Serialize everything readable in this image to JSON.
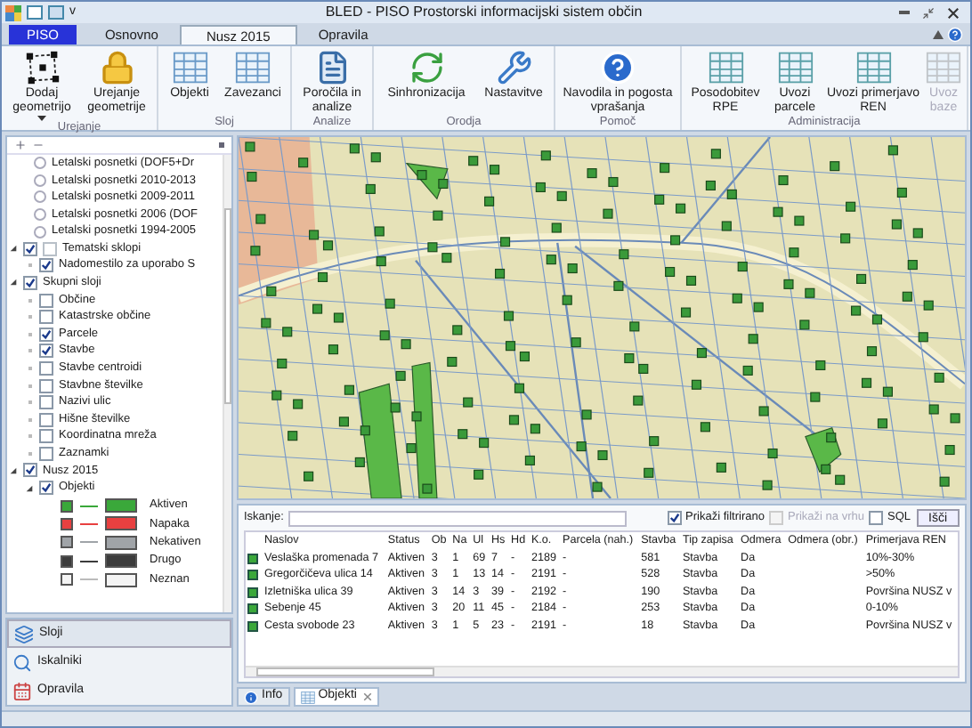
{
  "window": {
    "title": "BLED - PISO Prostorski informacijski sistem občin",
    "quick_access": "v"
  },
  "ribbon_tabs": [
    {
      "label": "PISO",
      "kind": "app",
      "selected": false
    },
    {
      "label": "Osnovno",
      "kind": "tab",
      "selected": false
    },
    {
      "label": "Nusz 2015",
      "kind": "tab",
      "selected": true
    },
    {
      "label": "Opravila",
      "kind": "tab",
      "selected": false
    }
  ],
  "ribbon_groups": [
    {
      "label": "Urejanje",
      "buttons": [
        {
          "label": "Dodaj geometrijo",
          "dropdown": true,
          "disabled": false
        },
        {
          "label": "Urejanje geometrije",
          "disabled": false
        }
      ]
    },
    {
      "label": "Sloj",
      "buttons": [
        {
          "label": "Objekti",
          "disabled": false
        },
        {
          "label": "Zavezanci",
          "disabled": false
        }
      ]
    },
    {
      "label": "Analize",
      "buttons": [
        {
          "label": "Poročila in analize",
          "disabled": false
        }
      ]
    },
    {
      "label": "Orodja",
      "buttons": [
        {
          "label": "Sinhronizacija",
          "disabled": false
        },
        {
          "label": "Nastavitve",
          "disabled": false
        }
      ]
    },
    {
      "label": "Pomoč",
      "buttons": [
        {
          "label": "Navodila in pogosta vprašanja",
          "disabled": false
        }
      ]
    },
    {
      "label": "Administracija",
      "buttons": [
        {
          "label": "Posodobitev RPE",
          "disabled": false
        },
        {
          "label": "Uvozi parcele",
          "disabled": false
        },
        {
          "label": "Uvozi primerjavo REN",
          "disabled": false
        },
        {
          "label": "Uvoz baze",
          "disabled": true
        }
      ]
    }
  ],
  "layers": {
    "partial_items": [
      {
        "label": "Letalski posnetki (DOF5+Dr",
        "selected": false
      },
      {
        "label": "Letalski posnetki 2010-2013",
        "selected": false
      },
      {
        "label": "Letalski posnetki 2009-2011",
        "selected": false
      },
      {
        "label": "Letalski posnetki 2006 (DOF",
        "selected": false
      },
      {
        "label": "Letalski posnetki 1994-2005",
        "selected": false
      }
    ],
    "tree": [
      {
        "label": "Tematski sklopi",
        "checked": true,
        "expanded": true,
        "children": [
          {
            "label": "Nadomestilo za uporabo S",
            "checked": true
          }
        ]
      },
      {
        "label": "Skupni sloji",
        "checked": true,
        "expanded": true,
        "children": [
          {
            "label": "Občine",
            "checked": false
          },
          {
            "label": "Katastrske občine",
            "checked": false
          },
          {
            "label": "Parcele",
            "checked": true
          },
          {
            "label": "Stavbe",
            "checked": true
          },
          {
            "label": "Stavbe centroidi",
            "checked": false
          },
          {
            "label": "Stavbne številke",
            "checked": false
          },
          {
            "label": "Nazivi ulic",
            "checked": false
          },
          {
            "label": "Hišne številke",
            "checked": false
          },
          {
            "label": "Koordinatna mreža",
            "checked": false
          },
          {
            "label": "Zaznamki",
            "checked": false
          }
        ]
      },
      {
        "label": "Nusz 2015",
        "checked": true,
        "expanded": true,
        "children": [
          {
            "label": "Objekti",
            "checked": true,
            "expanded": true,
            "legend": [
              {
                "label": "Aktiven",
                "color": "#3aa83a"
              },
              {
                "label": "Napaka",
                "color": "#e84040"
              },
              {
                "label": "Nekativen",
                "color": "#a0a4a8"
              },
              {
                "label": "Drugo",
                "color": "#3c3c3c"
              },
              {
                "label": "Neznan",
                "color": "#f4f4f4"
              }
            ]
          }
        ]
      }
    ]
  },
  "nav": [
    {
      "label": "Sloji",
      "selected": true
    },
    {
      "label": "Iskalniki",
      "selected": false
    },
    {
      "label": "Opravila",
      "selected": false
    }
  ],
  "search": {
    "label": "Iskanje:",
    "options": [
      {
        "label": "Prikaži filtrirano",
        "checked": true,
        "disabled": false
      },
      {
        "label": "Prikaži na vrhu",
        "checked": false,
        "disabled": true
      },
      {
        "label": "SQL",
        "checked": false,
        "disabled": false
      }
    ],
    "button": "Išči"
  },
  "table": {
    "columns": [
      "Naslov",
      "Status",
      "Ob",
      "Na",
      "Ul",
      "Hs",
      "Hd",
      "K.o.",
      "Parcela (nah.)",
      "Stavba",
      "Tip zapisa",
      "Odmera",
      "Odmera (obr.)",
      "Primerjava REN"
    ],
    "rows": [
      {
        "color": "#3aa83a",
        "cells": [
          "Veslaška promenada 7",
          "Aktiven",
          "3",
          "1",
          "69",
          "7",
          "-",
          "2189",
          "-",
          "581",
          "Stavba",
          "Da",
          "",
          "10%-30%"
        ]
      },
      {
        "color": "#3aa83a",
        "cells": [
          "Gregorčičeva ulica 14",
          "Aktiven",
          "3",
          "1",
          "13",
          "14",
          "-",
          "2191",
          "-",
          "528",
          "Stavba",
          "Da",
          "",
          ">50%"
        ]
      },
      {
        "color": "#3aa83a",
        "cells": [
          "Izletniška ulica 39",
          "Aktiven",
          "3",
          "14",
          "3",
          "39",
          "-",
          "2192",
          "-",
          "190",
          "Stavba",
          "Da",
          "",
          "Površina NUSZ v"
        ]
      },
      {
        "color": "#3aa83a",
        "cells": [
          "Sebenje 45",
          "Aktiven",
          "3",
          "20",
          "11",
          "45",
          "-",
          "2184",
          "-",
          "253",
          "Stavba",
          "Da",
          "",
          "0-10%"
        ]
      },
      {
        "color": "#3aa83a",
        "cells": [
          "Cesta svobode 23",
          "Aktiven",
          "3",
          "1",
          "5",
          "23",
          "-",
          "2191",
          "-",
          "18",
          "Stavba",
          "Da",
          "",
          "Površina NUSZ v"
        ]
      }
    ]
  },
  "bottom_tabs": [
    {
      "label": "Info",
      "closable": false,
      "selected": false
    },
    {
      "label": "Objekti",
      "closable": true,
      "selected": true
    }
  ]
}
